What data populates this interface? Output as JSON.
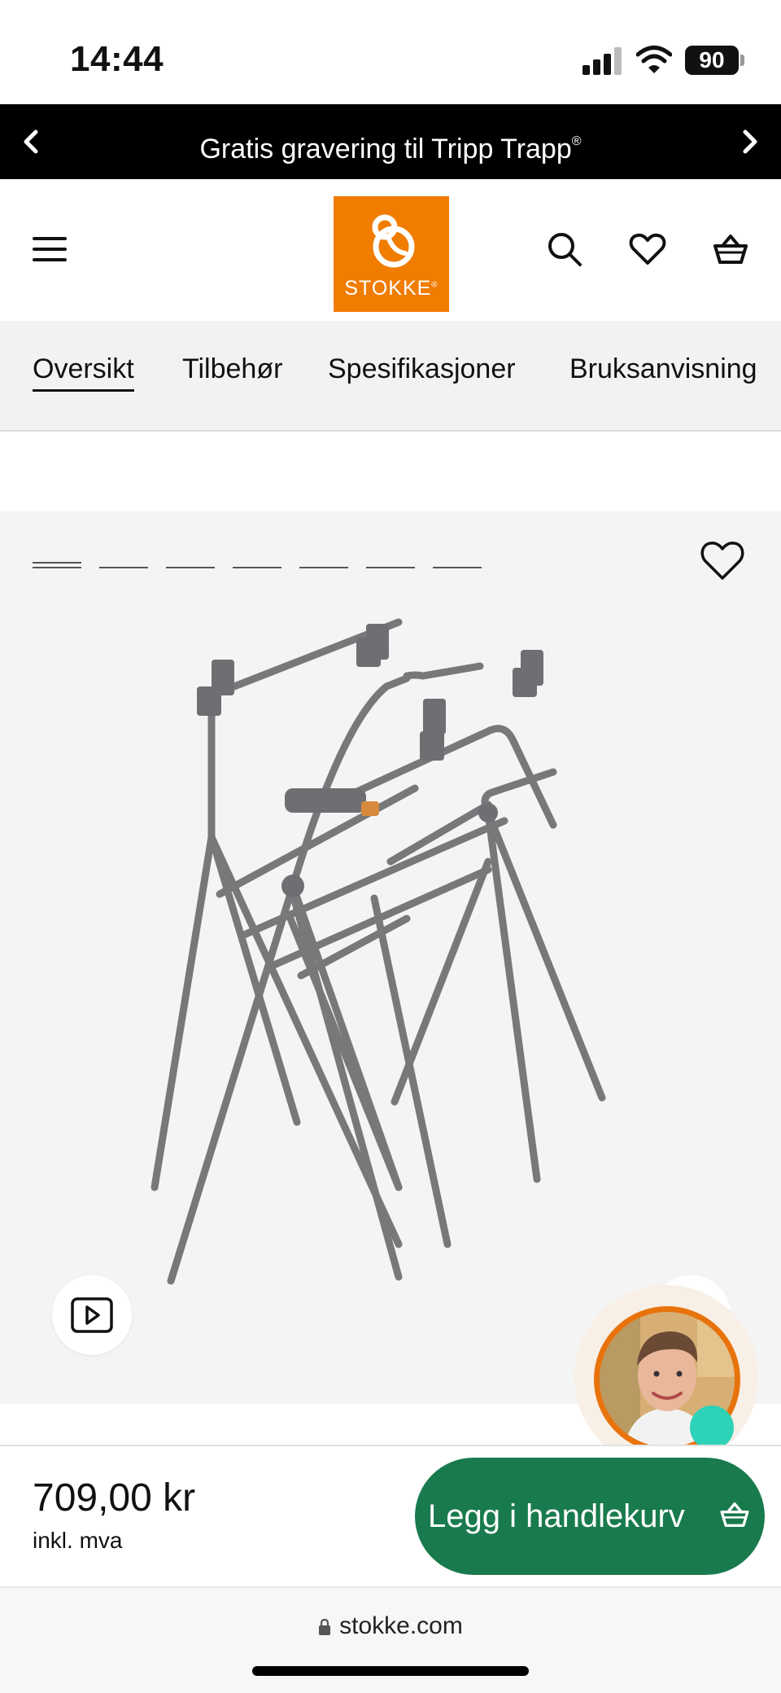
{
  "status_bar": {
    "time": "14:44",
    "battery": "90"
  },
  "promo": {
    "text": "Gratis gravering til Tripp Trapp",
    "mark": "®",
    "prev_icon": "chevron-left-icon",
    "next_icon": "chevron-right-icon"
  },
  "header": {
    "logo_text": "STOKKE",
    "logo_mark": "®",
    "brand_color": "#f07c00",
    "icons": [
      "menu-icon",
      "search-icon",
      "heart-icon",
      "basket-icon"
    ]
  },
  "tabs": [
    {
      "label": "Oversikt",
      "active": true
    },
    {
      "label": "Tilbehør",
      "active": false
    },
    {
      "label": "Spesifikasjoner",
      "active": false
    },
    {
      "label": "Bruksanvisning",
      "active": false
    }
  ],
  "gallery": {
    "image_count": 7,
    "active_index": 0,
    "product_image": "stand frame image",
    "buttons": [
      "play-video-icon",
      "favorite-heart-icon",
      "zoom-icon"
    ]
  },
  "buy_bar": {
    "price": "709,00 kr",
    "vat": "inkl. mva",
    "cart_button": "Legg i handlekurv",
    "button_color": "#197b4d"
  },
  "browser": {
    "url": "stokke.com"
  }
}
